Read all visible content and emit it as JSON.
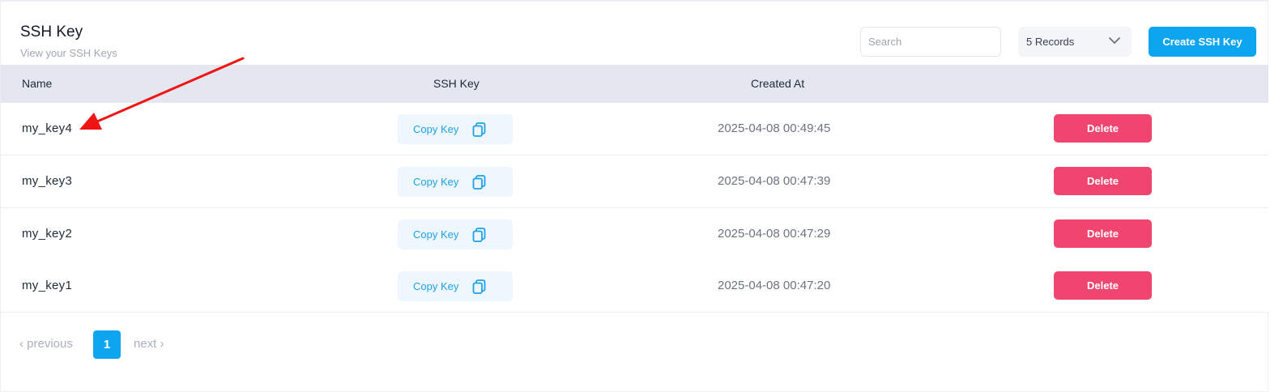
{
  "header": {
    "title": "SSH Key",
    "subtitle": "View your SSH Keys",
    "search_placeholder": "Search",
    "records_label": "5 Records",
    "create_label": "Create SSH Key"
  },
  "table": {
    "columns": [
      "Name",
      "SSH Key",
      "Created At"
    ],
    "copy_label": "Copy Key",
    "delete_label": "Delete",
    "rows": [
      {
        "name": "my_key4",
        "created_at": "2025-04-08 00:49:45"
      },
      {
        "name": "my_key3",
        "created_at": "2025-04-08 00:47:39"
      },
      {
        "name": "my_key2",
        "created_at": "2025-04-08 00:47:29"
      },
      {
        "name": "my_key1",
        "created_at": "2025-04-08 00:47:20"
      }
    ]
  },
  "pagination": {
    "previous_label": "‹ previous",
    "current_page": "1",
    "next_label": "next ›"
  },
  "icons": {
    "records_dropdown": "chevron-down-icon",
    "copy": "copy-icon"
  },
  "colors": {
    "accent": "#0ea5f0",
    "danger": "#f0456e",
    "header_bg": "#e4e7ef",
    "annotation": "#f01515"
  }
}
